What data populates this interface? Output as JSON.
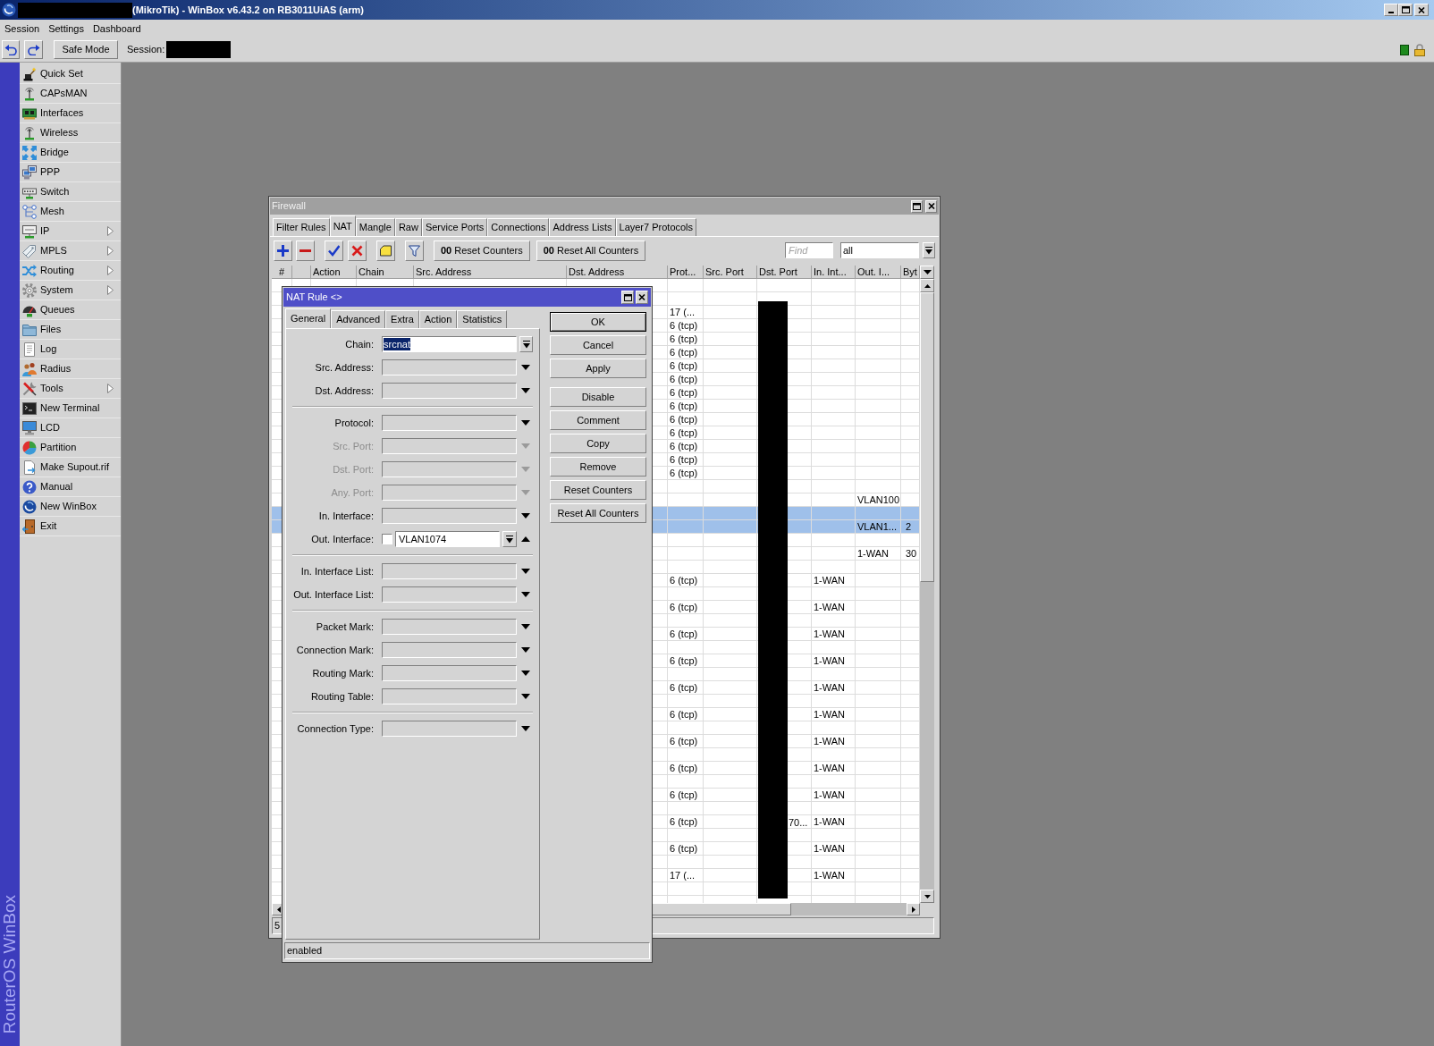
{
  "window": {
    "title": "(MikroTik) - WinBox v6.43.2 on RB3011UiAS (arm)"
  },
  "menu_bar": [
    "Session",
    "Settings",
    "Dashboard"
  ],
  "toolbar": {
    "safe_mode": "Safe Mode",
    "session_label": "Session:"
  },
  "sidebar": {
    "brand": "RouterOS WinBox",
    "items": [
      {
        "label": "Quick Set",
        "submenu": false
      },
      {
        "label": "CAPsMAN",
        "submenu": false
      },
      {
        "label": "Interfaces",
        "submenu": false
      },
      {
        "label": "Wireless",
        "submenu": false
      },
      {
        "label": "Bridge",
        "submenu": false
      },
      {
        "label": "PPP",
        "submenu": false
      },
      {
        "label": "Switch",
        "submenu": false
      },
      {
        "label": "Mesh",
        "submenu": false
      },
      {
        "label": "IP",
        "submenu": true
      },
      {
        "label": "MPLS",
        "submenu": true
      },
      {
        "label": "Routing",
        "submenu": true
      },
      {
        "label": "System",
        "submenu": true
      },
      {
        "label": "Queues",
        "submenu": false
      },
      {
        "label": "Files",
        "submenu": false
      },
      {
        "label": "Log",
        "submenu": false
      },
      {
        "label": "Radius",
        "submenu": false
      },
      {
        "label": "Tools",
        "submenu": true
      },
      {
        "label": "New Terminal",
        "submenu": false
      },
      {
        "label": "LCD",
        "submenu": false
      },
      {
        "label": "Partition",
        "submenu": false
      },
      {
        "label": "Make Supout.rif",
        "submenu": false
      },
      {
        "label": "Manual",
        "submenu": false
      },
      {
        "label": "New WinBox",
        "submenu": false
      },
      {
        "label": "Exit",
        "submenu": false
      }
    ]
  },
  "firewall": {
    "title": "Firewall",
    "tabs": [
      {
        "label": "Filter Rules",
        "selected": false
      },
      {
        "label": "NAT",
        "selected": true
      },
      {
        "label": "Mangle",
        "selected": false
      },
      {
        "label": "Raw",
        "selected": false
      },
      {
        "label": "Service Ports",
        "selected": false
      },
      {
        "label": "Connections",
        "selected": false
      },
      {
        "label": "Address Lists",
        "selected": false
      },
      {
        "label": "Layer7 Protocols",
        "selected": false
      }
    ],
    "buttons": [
      {
        "label": "**00** Reset Counters"
      },
      {
        "label": "**00** Reset All Counters"
      }
    ],
    "find": {
      "placeholder": "Find"
    },
    "filter": {
      "value": "all"
    },
    "table": {
      "columns": [
        "#",
        null,
        "Action",
        "Chain",
        "Src. Address",
        "Dst. Address",
        "Prot...",
        "Src. Port",
        "Dst. Port",
        "In. Int...",
        "Out. I...",
        "Byt"
      ],
      "rows": [
        {
          "selected": false
        },
        {
          "selected": false
        },
        {
          "selected": false,
          "cells": {
            "column_7": "17 (..."
          }
        },
        {
          "selected": false,
          "cells": {
            "column_7": "6 (tcp)"
          }
        },
        {
          "selected": false,
          "cells": {
            "column_7": "6 (tcp)"
          }
        },
        {
          "selected": false,
          "cells": {
            "column_7": "6 (tcp)"
          }
        },
        {
          "selected": false,
          "cells": {
            "column_7": "6 (tcp)"
          }
        },
        {
          "selected": false,
          "cells": {
            "column_7": "6 (tcp)"
          }
        },
        {
          "selected": false,
          "cells": {
            "column_7": "6 (tcp)"
          }
        },
        {
          "selected": false,
          "cells": {
            "column_7": "6 (tcp)"
          }
        },
        {
          "selected": false,
          "cells": {
            "column_7": "6 (tcp)"
          }
        },
        {
          "selected": false,
          "cells": {
            "column_7": "6 (tcp)"
          }
        },
        {
          "selected": false,
          "cells": {
            "column_7": "6 (tcp)"
          }
        },
        {
          "selected": false,
          "cells": {
            "column_7": "6 (tcp)"
          }
        },
        {
          "selected": false,
          "cells": {
            "column_7": "6 (tcp)"
          }
        },
        {
          "selected": false
        },
        {
          "selected": false,
          "cells": {
            "column_11": "VLAN100"
          }
        },
        {
          "selected": true
        },
        {
          "selected": true,
          "cells": {
            "column_11": "VLAN1...",
            "column_12": "2"
          }
        },
        {
          "selected": false
        },
        {
          "selected": false,
          "cells": {
            "column_11": "1-WAN",
            "column_12": "30"
          }
        },
        {
          "selected": false
        },
        {
          "selected": false,
          "cells": {
            "column_7": "6 (tcp)",
            "column_10": "1-WAN"
          }
        },
        {
          "selected": false
        },
        {
          "selected": false,
          "cells": {
            "column_7": "6 (tcp)",
            "column_10": "1-WAN"
          }
        },
        {
          "selected": false
        },
        {
          "selected": false,
          "cells": {
            "column_7": "6 (tcp)",
            "column_10": "1-WAN"
          }
        },
        {
          "selected": false
        },
        {
          "selected": false,
          "cells": {
            "column_7": "6 (tcp)",
            "column_10": "1-WAN"
          }
        },
        {
          "selected": false
        },
        {
          "selected": false,
          "cells": {
            "column_7": "6 (tcp)",
            "column_10": "1-WAN"
          }
        },
        {
          "selected": false
        },
        {
          "selected": false,
          "cells": {
            "column_7": "6 (tcp)",
            "column_10": "1-WAN"
          }
        },
        {
          "selected": false
        },
        {
          "selected": false,
          "cells": {
            "column_7": "6 (tcp)",
            "column_10": "1-WAN"
          }
        },
        {
          "selected": false
        },
        {
          "selected": false,
          "cells": {
            "column_7": "6 (tcp)",
            "column_10": "1-WAN"
          }
        },
        {
          "selected": false
        },
        {
          "selected": false,
          "cells": {
            "column_7": "6 (tcp)",
            "column_10": "1-WAN"
          }
        },
        {
          "selected": false
        },
        {
          "selected": false,
          "cells": {
            "column_7": "6 (tcp)",
            "column_9": "70...",
            "column_10": "1-WAN"
          }
        },
        {
          "selected": false
        },
        {
          "selected": false,
          "cells": {
            "column_7": "6 (tcp)",
            "column_10": "1-WAN"
          }
        },
        {
          "selected": false
        },
        {
          "selected": false,
          "cells": {
            "column_7": "17 (...",
            "column_10": "1-WAN"
          }
        },
        {
          "selected": false
        },
        {
          "selected": false
        }
      ]
    },
    "status_bar": "5"
  },
  "nat_rule": {
    "title": "NAT Rule <>",
    "tabs": [
      {
        "label": "General",
        "selected": true
      },
      {
        "label": "Advanced",
        "selected": false
      },
      {
        "label": "Extra",
        "selected": false
      },
      {
        "label": "Action",
        "selected": false
      },
      {
        "label": "Statistics",
        "selected": false
      }
    ],
    "field_groups": [
      [
        {
          "label": "Chain:",
          "kind": "combo",
          "value": "srcnat",
          "highlighted": true,
          "disabled": false
        },
        {
          "label": "Src. Address:",
          "kind": "condition",
          "expanded": false,
          "disabled": false
        },
        {
          "label": "Dst. Address:",
          "kind": "condition",
          "expanded": false,
          "disabled": false
        }
      ],
      [
        {
          "label": "Protocol:",
          "kind": "condition",
          "expanded": false,
          "disabled": false
        },
        {
          "label": "Src. Port:",
          "kind": "condition",
          "expanded": false,
          "disabled": true
        },
        {
          "label": "Dst. Port:",
          "kind": "condition",
          "expanded": false,
          "disabled": true
        },
        {
          "label": "Any. Port:",
          "kind": "condition",
          "expanded": false,
          "disabled": true
        },
        {
          "label": "In. Interface:",
          "kind": "condition",
          "expanded": false,
          "disabled": false
        },
        {
          "label": "Out. Interface:",
          "kind": "condition",
          "expanded": true,
          "disabled": false,
          "negated": false,
          "value": "VLAN1074"
        }
      ],
      [
        {
          "label": "In. Interface List:",
          "kind": "condition",
          "expanded": false,
          "disabled": false
        },
        {
          "label": "Out. Interface List:",
          "kind": "condition",
          "expanded": false,
          "disabled": false
        }
      ],
      [
        {
          "label": "Packet Mark:",
          "kind": "condition",
          "expanded": false,
          "disabled": false
        },
        {
          "label": "Connection Mark:",
          "kind": "condition",
          "expanded": false,
          "disabled": false
        },
        {
          "label": "Routing Mark:",
          "kind": "condition",
          "expanded": false,
          "disabled": false
        },
        {
          "label": "Routing Table:",
          "kind": "condition",
          "expanded": false,
          "disabled": false
        }
      ],
      [
        {
          "label": "Connection Type:",
          "kind": "condition",
          "expanded": false,
          "disabled": false
        }
      ]
    ],
    "button_groups": [
      [
        {
          "label": "OK",
          "default": true
        },
        {
          "label": "Cancel",
          "default": false
        },
        {
          "label": "Apply",
          "default": false
        }
      ],
      [
        {
          "label": "Disable",
          "default": false
        },
        {
          "label": "Comment",
          "default": false
        },
        {
          "label": "Copy",
          "default": false
        },
        {
          "label": "Remove",
          "default": false
        },
        {
          "label": "Reset Counters",
          "default": false
        },
        {
          "label": "Reset All Counters",
          "default": false
        }
      ]
    ],
    "status_bar": "enabled"
  }
}
